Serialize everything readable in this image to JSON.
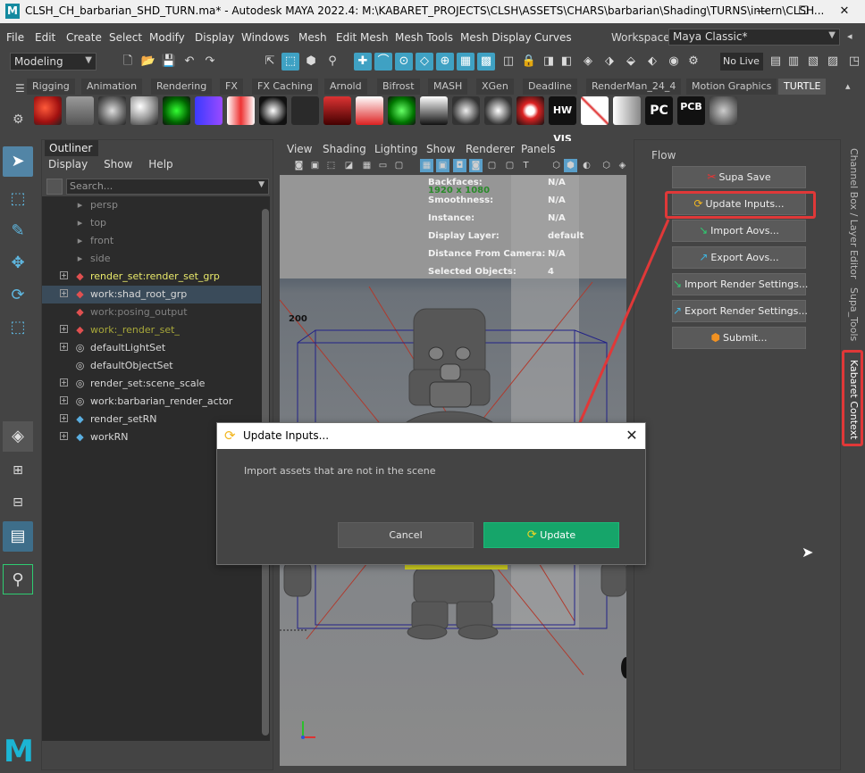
{
  "window": {
    "title": "CLSH_CH_barbarian_SHD_TURN.ma* - Autodesk MAYA 2022.4: M:\\KABARET_PROJECTS\\CLSH\\ASSETS\\CHARS\\barbarian\\Shading\\TURNS\\intern\\CLSH...",
    "logo": "M",
    "minimize": "—",
    "maximize": "☐",
    "close": "✕"
  },
  "menubar": {
    "items": [
      "File",
      "Edit",
      "Create",
      "Select",
      "Modify",
      "Display",
      "Windows",
      "Mesh",
      "Edit Mesh",
      "Mesh Tools",
      "Mesh Display",
      "Curves"
    ],
    "workspace_label": "Workspace:",
    "workspace_value": "Maya Classic*"
  },
  "statusline": {
    "mode": "Modeling",
    "no_live": "No Live"
  },
  "shelf": {
    "tabs": [
      "Rigging",
      "Animation",
      "Rendering",
      "FX",
      "FX Caching",
      "Arnold",
      "Bifrost",
      "MASH",
      "XGen",
      "Deadline",
      "RenderMan_24_4",
      "Motion Graphics",
      "TURTLE"
    ],
    "active_tab": "TURTLE",
    "icon_labels": [
      "HW VIS",
      "PC",
      "PCB"
    ]
  },
  "outliner": {
    "tab": "Outliner",
    "menus": [
      "Display",
      "Show",
      "Help"
    ],
    "search_placeholder": "Search...",
    "items": [
      {
        "label": "persp",
        "type": "camera",
        "color": "#8a8a8a",
        "expand": false
      },
      {
        "label": "top",
        "type": "camera",
        "color": "#8a8a8a",
        "expand": false
      },
      {
        "label": "front",
        "type": "camera",
        "color": "#8a8a8a",
        "expand": false
      },
      {
        "label": "side",
        "type": "camera",
        "color": "#8a8a8a",
        "expand": false
      },
      {
        "label": "render_set:render_set_grp",
        "type": "set",
        "color": "#e8e86a",
        "expand": true
      },
      {
        "label": "work:shad_root_grp",
        "type": "set",
        "color": "#d8d8d8",
        "expand": true,
        "selected": true
      },
      {
        "label": "work:posing_output",
        "type": "set",
        "color": "#808080",
        "expand": false
      },
      {
        "label": "work:_render_set_",
        "type": "set",
        "color": "#a8a83a",
        "expand": true
      },
      {
        "label": "defaultLightSet",
        "type": "objset",
        "color": "#d8d8d8",
        "expand": true
      },
      {
        "label": "defaultObjectSet",
        "type": "objset",
        "color": "#d8d8d8",
        "expand": false
      },
      {
        "label": "render_set:scene_scale",
        "type": "objset",
        "color": "#d8d8d8",
        "expand": true
      },
      {
        "label": "work:barbarian_render_actor",
        "type": "objset",
        "color": "#d8d8d8",
        "expand": true
      },
      {
        "label": "render_setRN",
        "type": "ref",
        "color": "#d8d8d8",
        "expand": true
      },
      {
        "label": "workRN",
        "type": "ref",
        "color": "#d8d8d8",
        "expand": true
      }
    ]
  },
  "viewport": {
    "menus": [
      "View",
      "Shading",
      "Lighting",
      "Show",
      "Renderer",
      "Panels"
    ],
    "resolution": "1920 x 1080",
    "hud": [
      {
        "label": "Backfaces:",
        "value": "N/A"
      },
      {
        "label": "Smoothness:",
        "value": "N/A"
      },
      {
        "label": "Instance:",
        "value": "N/A"
      },
      {
        "label": "Display Layer:",
        "value": "default"
      },
      {
        "label": "Distance From Camera:",
        "value": "N/A"
      },
      {
        "label": "Selected Objects:",
        "value": "4"
      }
    ],
    "ruler_mark": "200"
  },
  "flow": {
    "label": "Flow",
    "buttons": [
      {
        "label": "Supa Save",
        "icon": "save-icon"
      },
      {
        "label": "Update Inputs...",
        "icon": "refresh-icon"
      },
      {
        "label": "Import Aovs...",
        "icon": "import-icon"
      },
      {
        "label": "Export Aovs...",
        "icon": "export-icon"
      },
      {
        "label": "Import Render Settings...",
        "icon": "import-icon"
      },
      {
        "label": "Export Render Settings...",
        "icon": "export-icon"
      },
      {
        "label": "Submit...",
        "icon": "box-icon"
      }
    ]
  },
  "vtabs": [
    "Channel Box / Layer Editor",
    "Supa_Tools",
    "Kabaret Context"
  ],
  "dialog": {
    "title": "Update Inputs...",
    "message": "Import assets that are not in the scene",
    "cancel": "Cancel",
    "update": "Update",
    "close": "✕"
  },
  "colors": {
    "accent_red": "#e03838",
    "update_green": "#16a56a",
    "maya_blue": "#1cb5d4"
  }
}
